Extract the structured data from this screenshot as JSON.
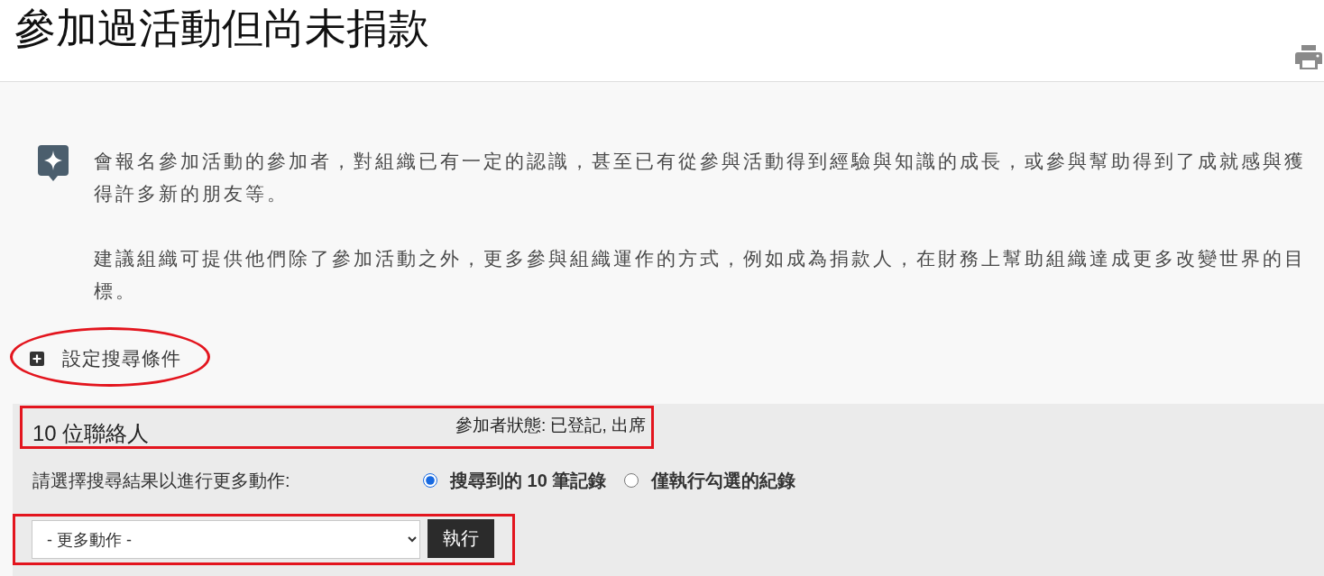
{
  "page": {
    "title": "參加過活動但尚未捐款"
  },
  "help": {
    "paragraphs": [
      "會報名參加活動的參加者，對組織已有一定的認識，甚至已有從參與活動得到經驗與知識的成長，或參與幫助得到了成就感與獲得許多新的朋友等。",
      "建議組織可提供他們除了參加活動之外，更多參與組織運作的方式，例如成為捐款人，在財務上幫助組織達成更多改變世界的目標。"
    ]
  },
  "search_toggle": {
    "label": "設定搜尋條件",
    "expanded": false,
    "highlighted": true
  },
  "results": {
    "count_label": "10 位聯絡人",
    "filter_summary": "參加者狀態: 已登記, 出席",
    "highlighted": true
  },
  "selection": {
    "prompt": "請選擇搜尋結果以進行更多動作:",
    "options": [
      {
        "label": "搜尋到的 10 筆記錄",
        "selected": true
      },
      {
        "label": "僅執行勾選的紀錄",
        "selected": false
      }
    ]
  },
  "actions": {
    "dropdown_value": "- 更多動作 -",
    "button": "執行",
    "highlighted": true
  }
}
